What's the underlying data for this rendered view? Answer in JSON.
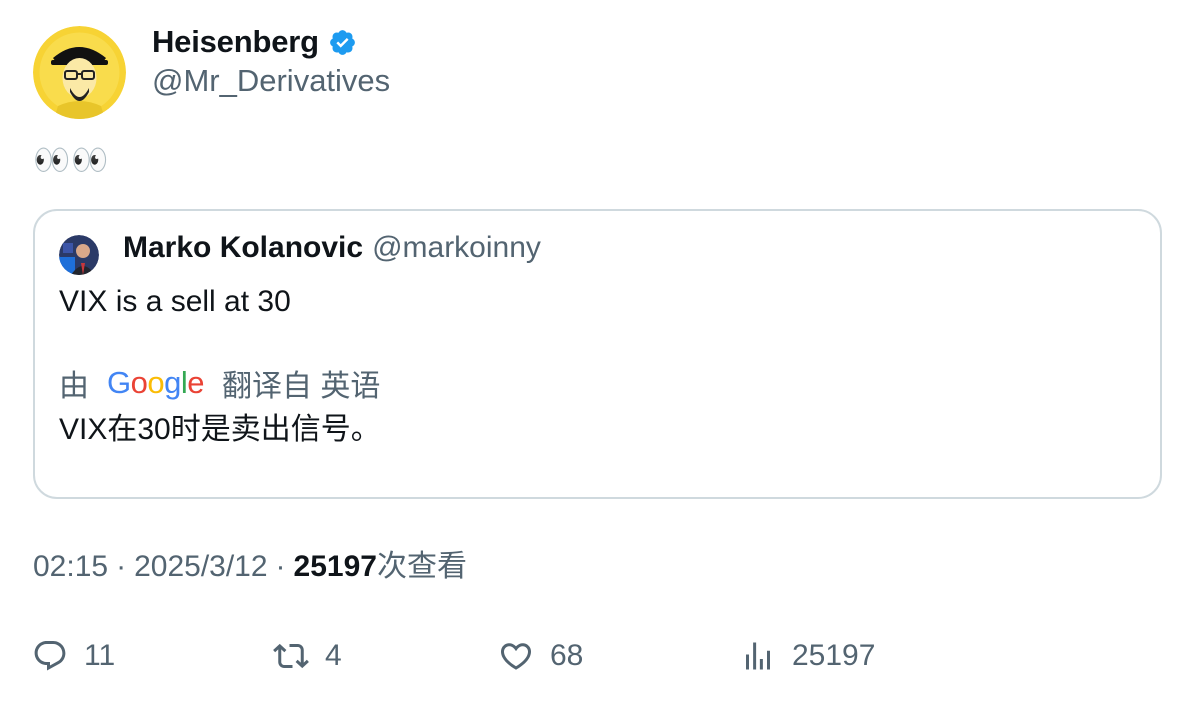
{
  "author": {
    "name": "Heisenberg",
    "handle": "@Mr_Derivatives",
    "verified": true
  },
  "tweet_text": "👀👀",
  "quote": {
    "name": "Marko Kolanovic",
    "handle": "@markoinny",
    "text": "VIX is a sell at 30",
    "translation": {
      "by_label": "由",
      "provider": "Google",
      "from_label": "翻译自 英语",
      "text": "VIX在30时是卖出信号。"
    }
  },
  "meta": {
    "time": "02:15",
    "separator": "·",
    "date": "2025/3/12",
    "views_count": "25197",
    "views_label": "次查看"
  },
  "actions": {
    "replies": "11",
    "retweets": "4",
    "likes": "68",
    "views": "25197"
  },
  "colors": {
    "text_primary": "#0f1419",
    "text_secondary": "#536471",
    "verified_blue": "#1d9bf0",
    "border": "#cfd9de"
  }
}
